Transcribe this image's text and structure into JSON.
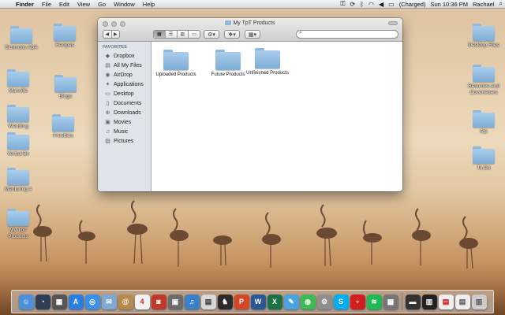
{
  "menubar": {
    "apple_icon": "apple-icon",
    "app_name": "Finder",
    "menus": [
      "File",
      "Edit",
      "View",
      "Go",
      "Window",
      "Help"
    ],
    "battery_text": "(Charged)",
    "clock": "Sun 10:36 PM",
    "user": "Rachael",
    "status_icons": [
      "lock-icon",
      "sync-icon",
      "bluetooth-icon",
      "wifi-icon",
      "volume-icon",
      "battery-icon"
    ]
  },
  "desktop_icons": [
    {
      "label": "Simmons ABA"
    },
    {
      "label": "Recipes"
    },
    {
      "label": "Manville"
    },
    {
      "label": "Blogs"
    },
    {
      "label": "Wedding"
    },
    {
      "label": "Freebies"
    },
    {
      "label": "Verbal Bx"
    },
    {
      "label": "Mentoring 4"
    },
    {
      "label": "My TpT Products"
    },
    {
      "label": "Desktop Files"
    },
    {
      "label": "Resumes and Coverletters"
    },
    {
      "label": "RS"
    },
    {
      "label": "To Do"
    }
  ],
  "finder": {
    "title": "My TpT Products",
    "search_placeholder": "",
    "sidebar_heading": "FAVORITES",
    "sidebar_items": [
      {
        "label": "Dropbox",
        "icon": "dropbox-icon"
      },
      {
        "label": "All My Files",
        "icon": "all-files-icon"
      },
      {
        "label": "AirDrop",
        "icon": "airdrop-icon"
      },
      {
        "label": "Applications",
        "icon": "applications-icon"
      },
      {
        "label": "Desktop",
        "icon": "desktop-icon"
      },
      {
        "label": "Documents",
        "icon": "documents-icon"
      },
      {
        "label": "Downloads",
        "icon": "downloads-icon"
      },
      {
        "label": "Movies",
        "icon": "movies-icon"
      },
      {
        "label": "Music",
        "icon": "music-icon"
      },
      {
        "label": "Pictures",
        "icon": "pictures-icon"
      }
    ],
    "folders": [
      {
        "label": "Uploaded Products"
      },
      {
        "label": "Future Products"
      },
      {
        "label": "Unfinished Products"
      }
    ]
  },
  "dock_icons": [
    "finder-icon",
    "dashboard-icon",
    "calculator-icon",
    "app-store-icon",
    "safari-icon",
    "mail-icon",
    "contacts-icon",
    "calendar-icon",
    "photo-booth-icon",
    "iphoto-icon",
    "itunes-icon",
    "preview-icon",
    "chess-icon",
    "powerpoint-icon",
    "word-icon",
    "excel-icon",
    "messages-icon",
    "chrome-icon",
    "system-preferences-icon",
    "skype-icon",
    "acrobat-icon",
    "spotify-icon",
    "app-icon",
    "dvd-player-icon",
    "activity-monitor-icon",
    "pdf-document-icon",
    "text-document-icon",
    "trash-icon"
  ]
}
